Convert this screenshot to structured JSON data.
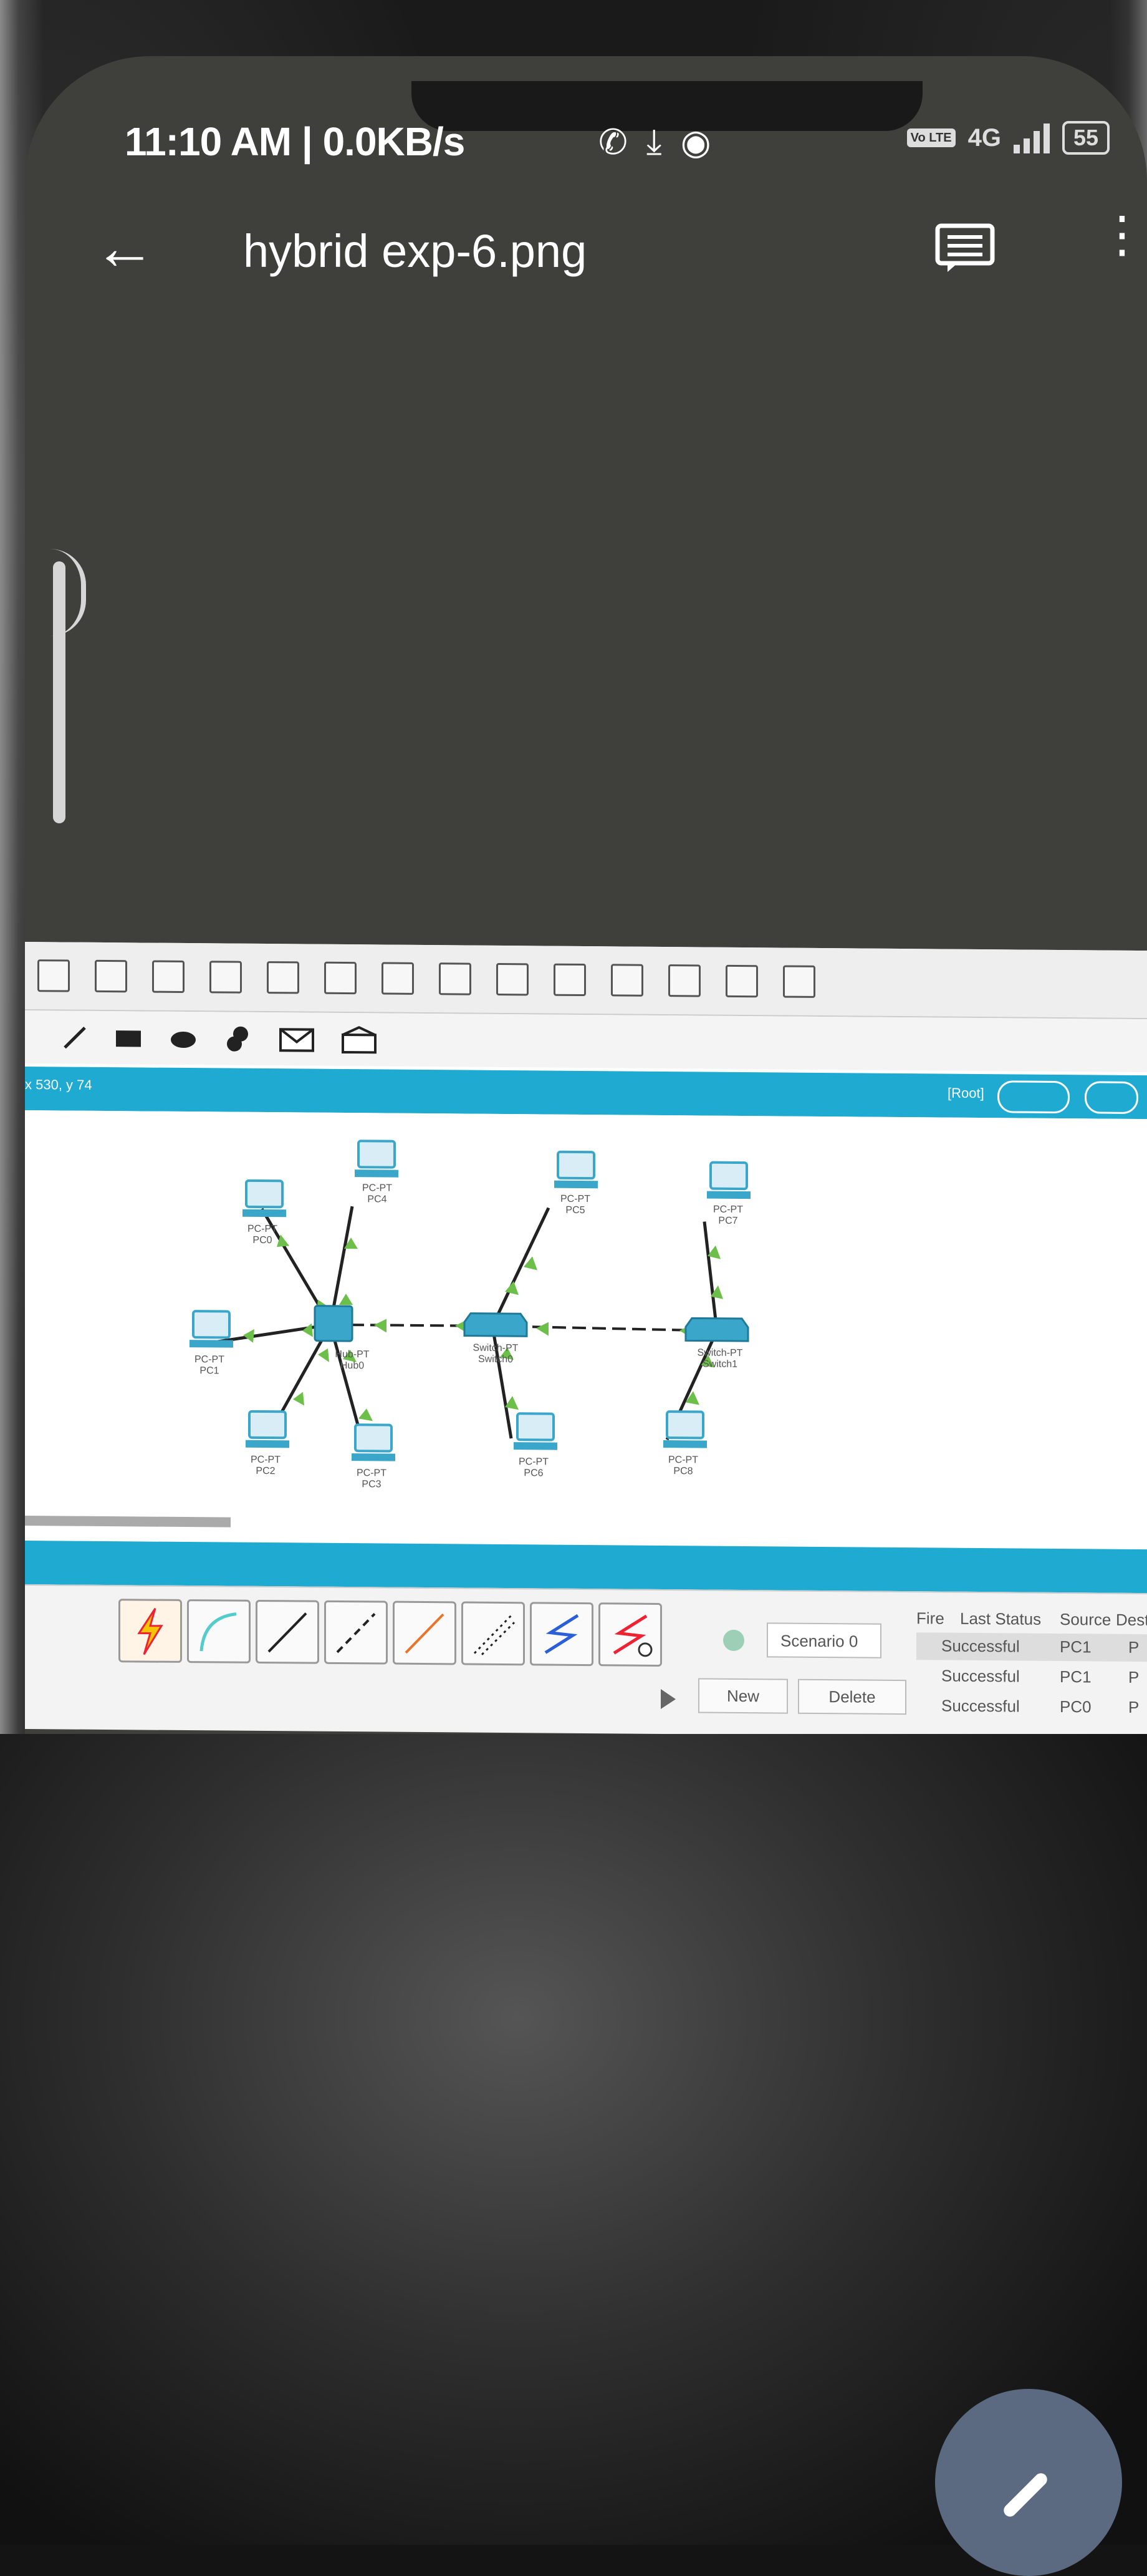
{
  "statusbar": {
    "time": "11:10 AM",
    "separator": "|",
    "speed": "0.0KB/s",
    "volte": "Vo LTE",
    "network": "4G",
    "battery": "55"
  },
  "appbar": {
    "title": "hybrid exp-6.png"
  },
  "packet_tracer": {
    "coords": "x 530, y 74",
    "root": "[Root]",
    "devices": [
      {
        "type": "PC-PT",
        "name": "PC0"
      },
      {
        "type": "PC-PT",
        "name": "PC1"
      },
      {
        "type": "PC-PT",
        "name": "PC2"
      },
      {
        "type": "PC-PT",
        "name": "PC3"
      },
      {
        "type": "PC-PT",
        "name": "PC4"
      },
      {
        "type": "PC-PT",
        "name": "PC5"
      },
      {
        "type": "PC-PT",
        "name": "PC6"
      },
      {
        "type": "PC-PT",
        "name": "PC7"
      },
      {
        "type": "PC-PT",
        "name": "PC8"
      },
      {
        "type": "Hub-PT",
        "name": "Hub0"
      },
      {
        "type": "Switch-PT",
        "name": "Switch0"
      },
      {
        "type": "Switch-PT",
        "name": "Switch1"
      }
    ],
    "scenario": "Scenario 0",
    "new_label": "New",
    "delete_label": "Delete",
    "pdu_headers": [
      "Fire",
      "Last Status",
      "Source",
      "Destin"
    ],
    "pdu_rows": [
      {
        "status": "Successful",
        "source": "PC1",
        "dest": "P"
      },
      {
        "status": "Successful",
        "source": "PC1",
        "dest": "P"
      },
      {
        "status": "Successful",
        "source": "PC0",
        "dest": "P"
      }
    ],
    "colors": {
      "accent": "#1eaad1",
      "device": "#3aa6c9",
      "link_green": "#6cc04a"
    }
  }
}
